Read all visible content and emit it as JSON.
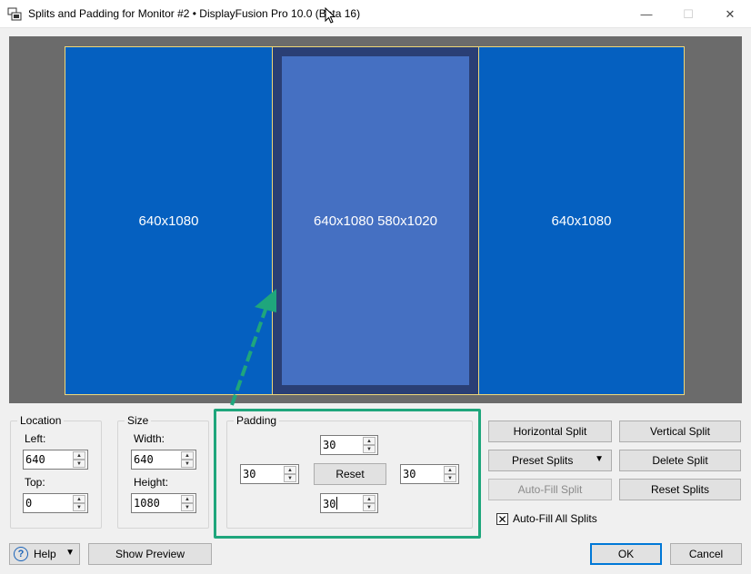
{
  "window": {
    "title": "Splits and Padding for Monitor #2 • DisplayFusion Pro 10.0 (Beta 16)",
    "icons": {
      "app": "displayfusion-icon",
      "minimize": "minimize-icon",
      "maximize": "maximize-icon",
      "close": "close-icon"
    }
  },
  "preview": {
    "splits": [
      {
        "label": "640x1080"
      },
      {
        "label": "640x1080 580x1020",
        "selected": true
      },
      {
        "label": "640x1080"
      }
    ],
    "colors": {
      "background": "#6b6b6b",
      "split": "#0560c0",
      "selected_outer": "#2a3f75",
      "selected_inner": "#4570c2",
      "border": "#f0d878"
    }
  },
  "location": {
    "group_label": "Location",
    "left_label": "Left:",
    "left_value": "640",
    "top_label": "Top:",
    "top_value": "0"
  },
  "size": {
    "group_label": "Size",
    "width_label": "Width:",
    "width_value": "640",
    "height_label": "Height:",
    "height_value": "1080"
  },
  "padding": {
    "group_label": "Padding",
    "top_value": "30",
    "left_value": "30",
    "right_value": "30",
    "bottom_value": "30",
    "reset_label": "Reset",
    "highlight_color": "#1fa67c"
  },
  "actions": {
    "horizontal_split": "Horizontal Split",
    "vertical_split": "Vertical Split",
    "preset_splits": "Preset Splits",
    "delete_split": "Delete Split",
    "auto_fill_split": "Auto-Fill Split",
    "reset_splits": "Reset Splits",
    "auto_fill_all_label": "Auto-Fill All Splits",
    "auto_fill_all_checked": true
  },
  "footer": {
    "help_label": "Help",
    "show_preview_label": "Show Preview",
    "ok_label": "OK",
    "cancel_label": "Cancel"
  }
}
